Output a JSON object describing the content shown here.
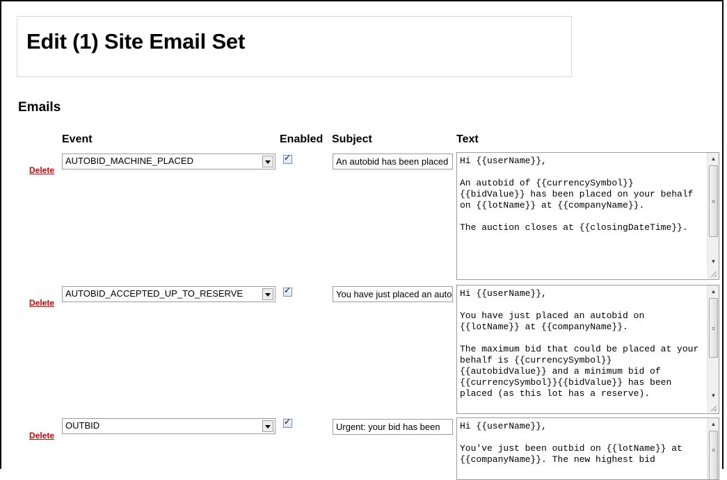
{
  "page": {
    "title": "Edit (1) Site Email Set",
    "section_title": "Emails"
  },
  "columns": {
    "event": "Event",
    "enabled": "Enabled",
    "subject": "Subject",
    "text": "Text"
  },
  "colors": {
    "delete_link": "#e00000"
  },
  "rows": [
    {
      "delete_label": "Delete",
      "event": "AUTOBID_MACHINE_PLACED",
      "enabled": true,
      "subject": "An autobid has been placed",
      "text": "Hi {{userName}},\n\nAn autobid of {{currencySymbol}} {{bidValue}} has been placed on your behalf on {{lotName}} at {{companyName}}.\n\nThe auction closes at {{closingDateTime}}."
    },
    {
      "delete_label": "Delete",
      "event": "AUTOBID_ACCEPTED_UP_TO_RESERVE",
      "enabled": true,
      "subject": "You have just placed an autobid",
      "text": "Hi {{userName}},\n\nYou have just placed an autobid on {{lotName}} at {{companyName}}.\n\nThe maximum bid that could be placed at your behalf is {{currencySymbol}} {{autobidValue}} and a minimum bid of {{currencySymbol}}{{bidValue}} has been placed (as this lot has a reserve)."
    },
    {
      "delete_label": "Delete",
      "event": "OUTBID",
      "enabled": true,
      "subject": "Urgent: your bid has been",
      "text": "Hi {{userName}},\n\nYou've just been outbid on {{lotName}} at {{companyName}}. The new highest bid"
    }
  ]
}
